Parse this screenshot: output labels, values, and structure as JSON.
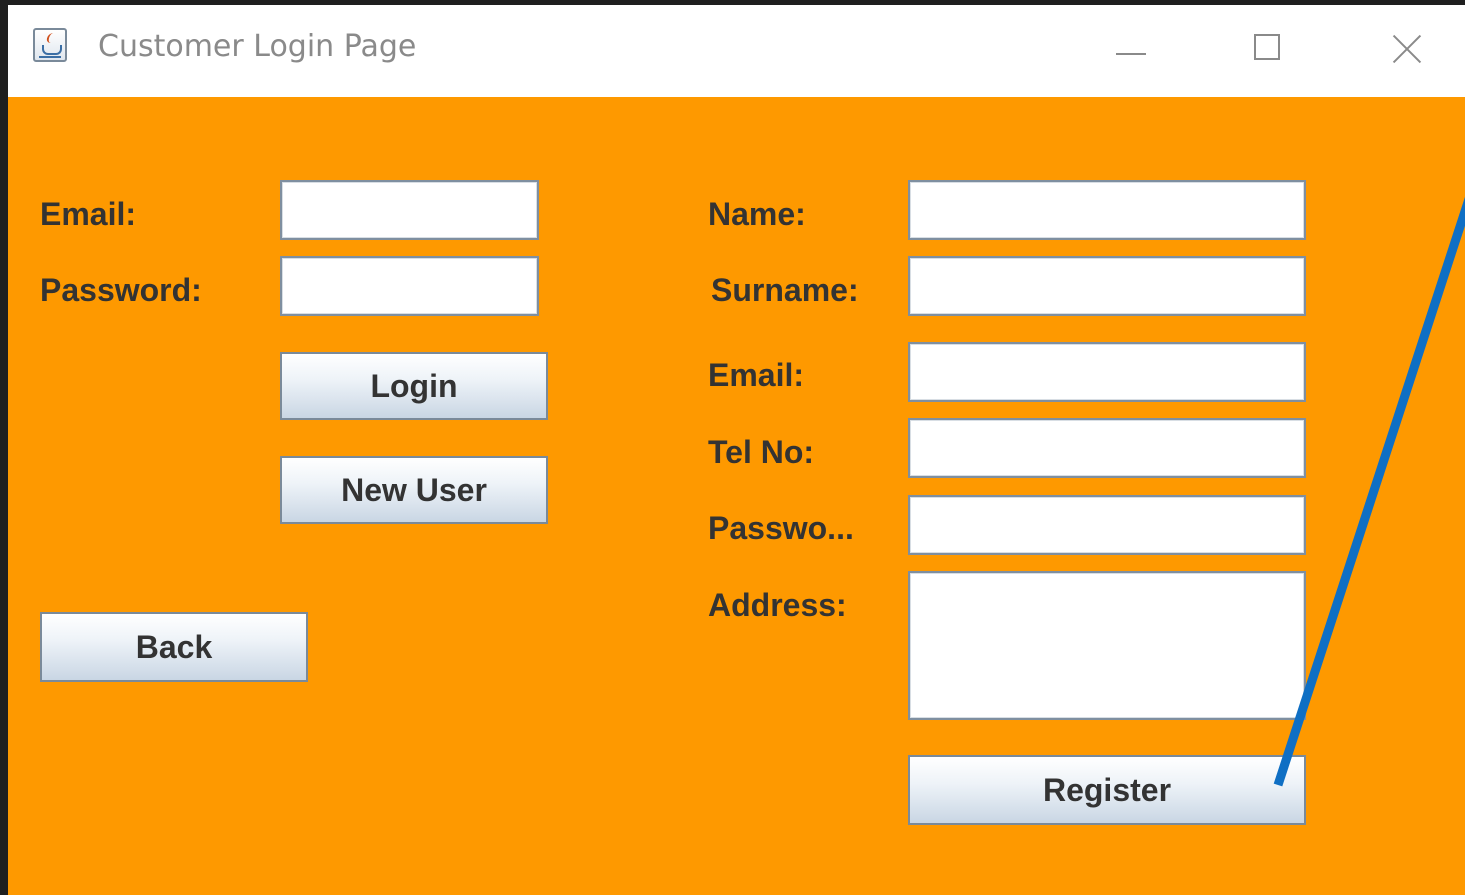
{
  "window": {
    "title": "Customer Login Page",
    "app_icon": "java-cup-icon",
    "controls": [
      "minimize-icon",
      "maximize-icon",
      "close-icon"
    ],
    "background_color": "#fe9900"
  },
  "login": {
    "email_label": "Email:",
    "password_label": "Password:",
    "email_value": "",
    "password_value": "",
    "login_button": "Login",
    "new_user_button": "New User",
    "back_button": "Back"
  },
  "register": {
    "name_label": "Name:",
    "surname_label": "Surname:",
    "email_label": "Email:",
    "tel_label": "Tel No:",
    "password_label": "Passwo...",
    "address_label": "Address:",
    "name_value": "",
    "surname_value": "",
    "email_value": "",
    "tel_value": "",
    "password_value": "",
    "address_value": "",
    "register_button": "Register"
  },
  "annotation": {
    "type": "arrow-line",
    "color": "#0f6fc4"
  }
}
